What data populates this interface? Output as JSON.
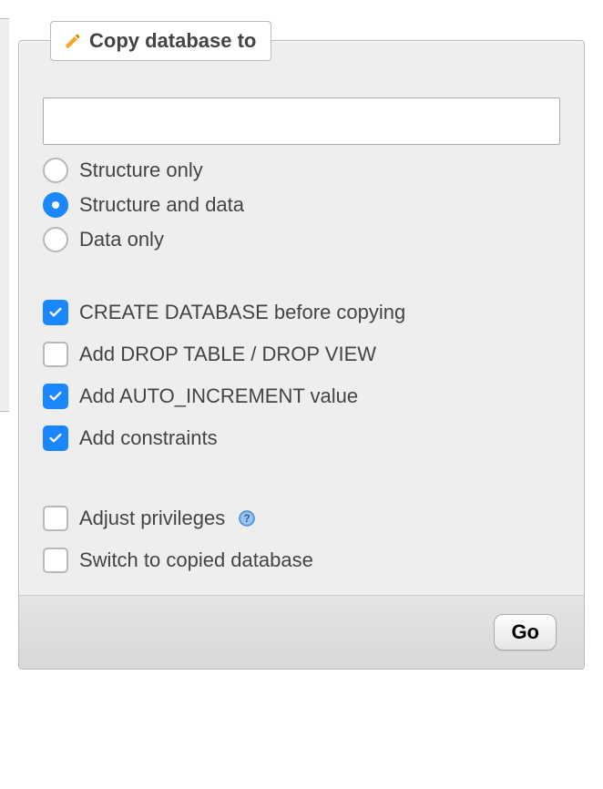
{
  "panel": {
    "title": "Copy database to",
    "input_value": "",
    "go_label": "Go"
  },
  "radios": {
    "structure_only": "Structure only",
    "structure_and_data": "Structure and data",
    "data_only": "Data only",
    "selected": "structure_and_data"
  },
  "checkboxes": {
    "create_db": {
      "label": "CREATE DATABASE before copying",
      "checked": true
    },
    "drop_table": {
      "label": "Add DROP TABLE / DROP VIEW",
      "checked": false
    },
    "auto_increment": {
      "label": "Add AUTO_INCREMENT value",
      "checked": true
    },
    "add_constraints": {
      "label": "Add constraints",
      "checked": true
    },
    "adjust_privileges": {
      "label": "Adjust privileges",
      "checked": false
    },
    "switch_to_copied": {
      "label": "Switch to copied database",
      "checked": false
    }
  }
}
